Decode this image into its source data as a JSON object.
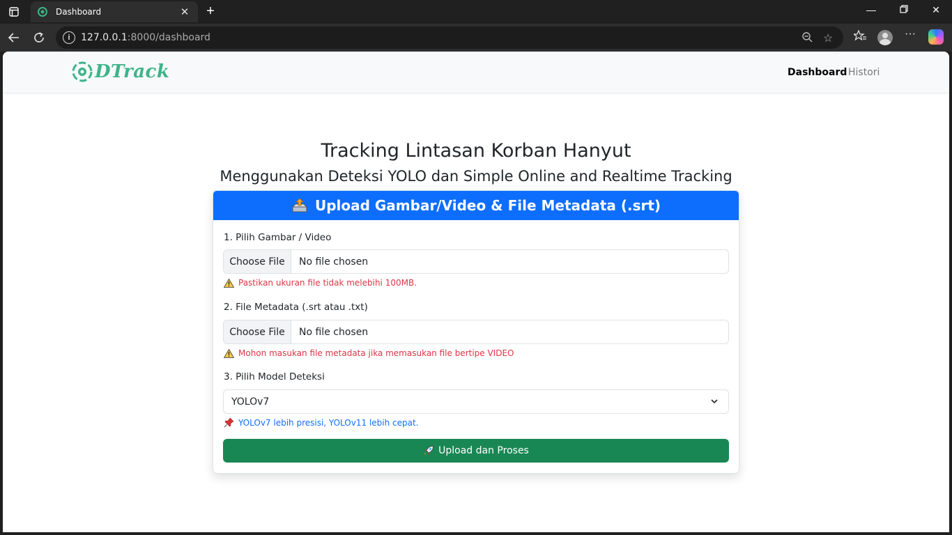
{
  "browser": {
    "tab_title": "Dashboard",
    "url_host": "127.0.0.1",
    "url_rest": ":8000/dashboard"
  },
  "navbar": {
    "brand": "DTrack",
    "links": [
      "Dashboard",
      "Histori"
    ]
  },
  "page": {
    "title": "Tracking Lintasan Korban Hanyut",
    "subtitle": "Menggunakan Deteksi YOLO dan Simple Online and Realtime Tracking"
  },
  "card": {
    "header": "Upload Gambar/Video & File Metadata (.srt)",
    "field1": {
      "label": "1. Pilih Gambar / Video",
      "button": "Choose File",
      "value": "No file chosen",
      "hint": "Pastikan ukuran file tidak melebihi 100MB."
    },
    "field2": {
      "label": "2. File Metadata (.srt atau .txt)",
      "button": "Choose File",
      "value": "No file chosen",
      "hint": "Mohon masukan file metadata jika memasukan file bertipe VIDEO"
    },
    "field3": {
      "label": "3. Pilih Model Deteksi",
      "selected": "YOLOv7",
      "hint": "YOLOv7 lebih presisi, YOLOv11 lebih cepat."
    },
    "submit": "Upload dan Proses"
  },
  "colors": {
    "primary": "#0d6efd",
    "success": "#198754",
    "danger": "#dc3545",
    "brand": "#3eb489"
  }
}
